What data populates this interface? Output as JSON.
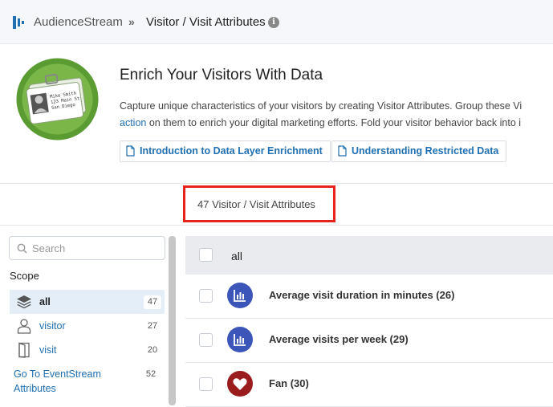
{
  "breadcrumb": {
    "app": "AudienceStream",
    "separator": "»",
    "page": "Visitor / Visit Attributes",
    "info": "i"
  },
  "hero": {
    "title": "Enrich Your Visitors With Data",
    "line1": "Capture unique characteristics of your visitors by creating Visitor Attributes. Group these Vi",
    "line2_link": "action",
    "line2_rest": " on them to enrich your digital marketing efforts. Fold your visitor behavior back into i",
    "badge_text": [
      "Mike Smith",
      "123 Main St",
      "San Diego"
    ],
    "links": [
      {
        "label": "Introduction to Data Layer Enrichment"
      },
      {
        "label": "Understanding Restricted Data"
      }
    ]
  },
  "count_label": "47 Visitor / Visit Attributes",
  "sidebar": {
    "search_placeholder": "Search",
    "scope_heading": "Scope",
    "scopes": [
      {
        "name": "all",
        "count": "47",
        "icon": "layers-icon",
        "active": true
      },
      {
        "name": "visitor",
        "count": "27",
        "icon": "person-icon",
        "active": false
      },
      {
        "name": "visit",
        "count": "20",
        "icon": "door-icon",
        "active": false
      }
    ],
    "event_link": "Go To EventStream Attributes",
    "event_count": "52"
  },
  "list": {
    "header": "all",
    "rows": [
      {
        "label": "Average visit duration in minutes (26)",
        "icon": "bar-chart-icon",
        "color": "#3b56b8"
      },
      {
        "label": "Average visits per week (29)",
        "icon": "bar-chart-icon",
        "color": "#3b56b8"
      },
      {
        "label": "Fan (30)",
        "icon": "heart-icon",
        "color": "#9b1c1c"
      }
    ]
  },
  "colors": {
    "accent": "#1f6fb2",
    "highlight_box": "#e8241a",
    "active_scope": "#e3eef8"
  }
}
